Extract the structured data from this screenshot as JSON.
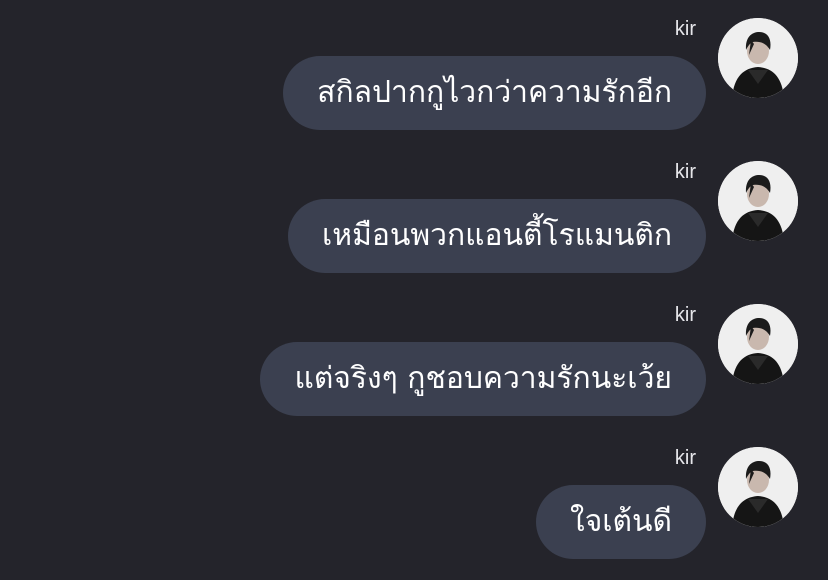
{
  "messages": [
    {
      "sender": "kir",
      "text": "สกิลปากกูไวกว่าความรักอีก",
      "avatar_icon": "profile-photo"
    },
    {
      "sender": "kir",
      "text": "เหมือนพวกแอนตี้โรแมนติก",
      "avatar_icon": "profile-photo"
    },
    {
      "sender": "kir",
      "text": "แต่จริงๆ กูชอบความรักนะเว้ย",
      "avatar_icon": "profile-photo"
    },
    {
      "sender": "kir",
      "text": "ใจเต้นดี",
      "avatar_icon": "profile-photo"
    }
  ],
  "colors": {
    "background": "#24242b",
    "bubble": "#3b4050",
    "text": "#ffffff"
  }
}
